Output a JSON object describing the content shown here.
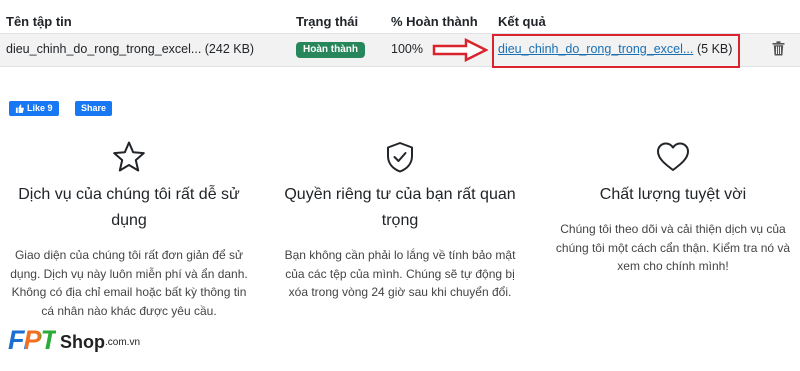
{
  "table": {
    "headers": {
      "file_name": "Tên tập tin",
      "status": "Trạng thái",
      "percent": "% Hoàn thành",
      "result": "Kết quả"
    },
    "row": {
      "file_name": "dieu_chinh_do_rong_trong_excel... (242 KB)",
      "status": "Hoàn thành",
      "percent": "100%",
      "result_link": "dieu_chinh_do_rong_trong_excel...",
      "result_size": "(5 KB)"
    }
  },
  "social": {
    "like_label": "Like 9",
    "share_label": "Share"
  },
  "features": [
    {
      "icon": "star-icon",
      "title": "Dịch vụ của chúng tôi rất dễ sử dụng",
      "description": "Giao diện của chúng tôi rất đơn giản để sử dụng. Dịch vụ này luôn miễn phí và ẩn danh. Không có địa chỉ email hoặc bất kỳ thông tin cá nhân nào khác được yêu cầu."
    },
    {
      "icon": "shield-check-icon",
      "title": "Quyền riêng tư của bạn rất quan trọng",
      "description": "Bạn không cần phải lo lắng về tính bảo mật của các tệp của mình. Chúng sẽ tự động bị xóa trong vòng 24 giờ sau khi chuyển đổi."
    },
    {
      "icon": "heart-icon",
      "title": "Chất lượng tuyệt vời",
      "description": "Chúng tôi theo dõi và cải thiện dịch vụ của chúng tôi một cách cẩn thận. Kiểm tra nó và xem cho chính mình!"
    }
  ],
  "logo": {
    "brand": "FPT",
    "shop": "Shop",
    "domain": ".com.vn"
  },
  "colors": {
    "badge_green": "#28875a",
    "highlight_red": "#d9232d",
    "link_blue": "#1a6fb3",
    "facebook_blue": "#1877f2"
  }
}
